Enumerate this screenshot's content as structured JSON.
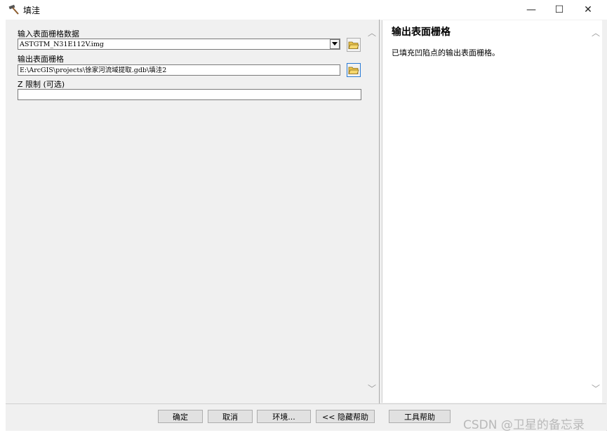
{
  "window": {
    "title": "填洼",
    "minimize": "—",
    "maximize": "☐",
    "close": "✕"
  },
  "form": {
    "input_label": "输入表面栅格数据",
    "input_value": "ASTGTM_N31E112V.img",
    "output_label": "输出表面栅格",
    "output_value": "E:\\ArcGIS\\projects\\徐家河流域提取.gdb\\填洼2",
    "z_label": "Z 限制 (可选)",
    "z_value": ""
  },
  "help": {
    "title": "输出表面栅格",
    "body": "已填充凹陷点的输出表面栅格。"
  },
  "buttons": {
    "ok": "确定",
    "cancel": "取消",
    "environments": "环境...",
    "hide_help": "<< 隐藏帮助",
    "tool_help": "工具帮助"
  },
  "watermark": "CSDN @卫星的备忘录",
  "icons": {
    "title": "hammer-icon",
    "folder": "open-folder-icon"
  }
}
